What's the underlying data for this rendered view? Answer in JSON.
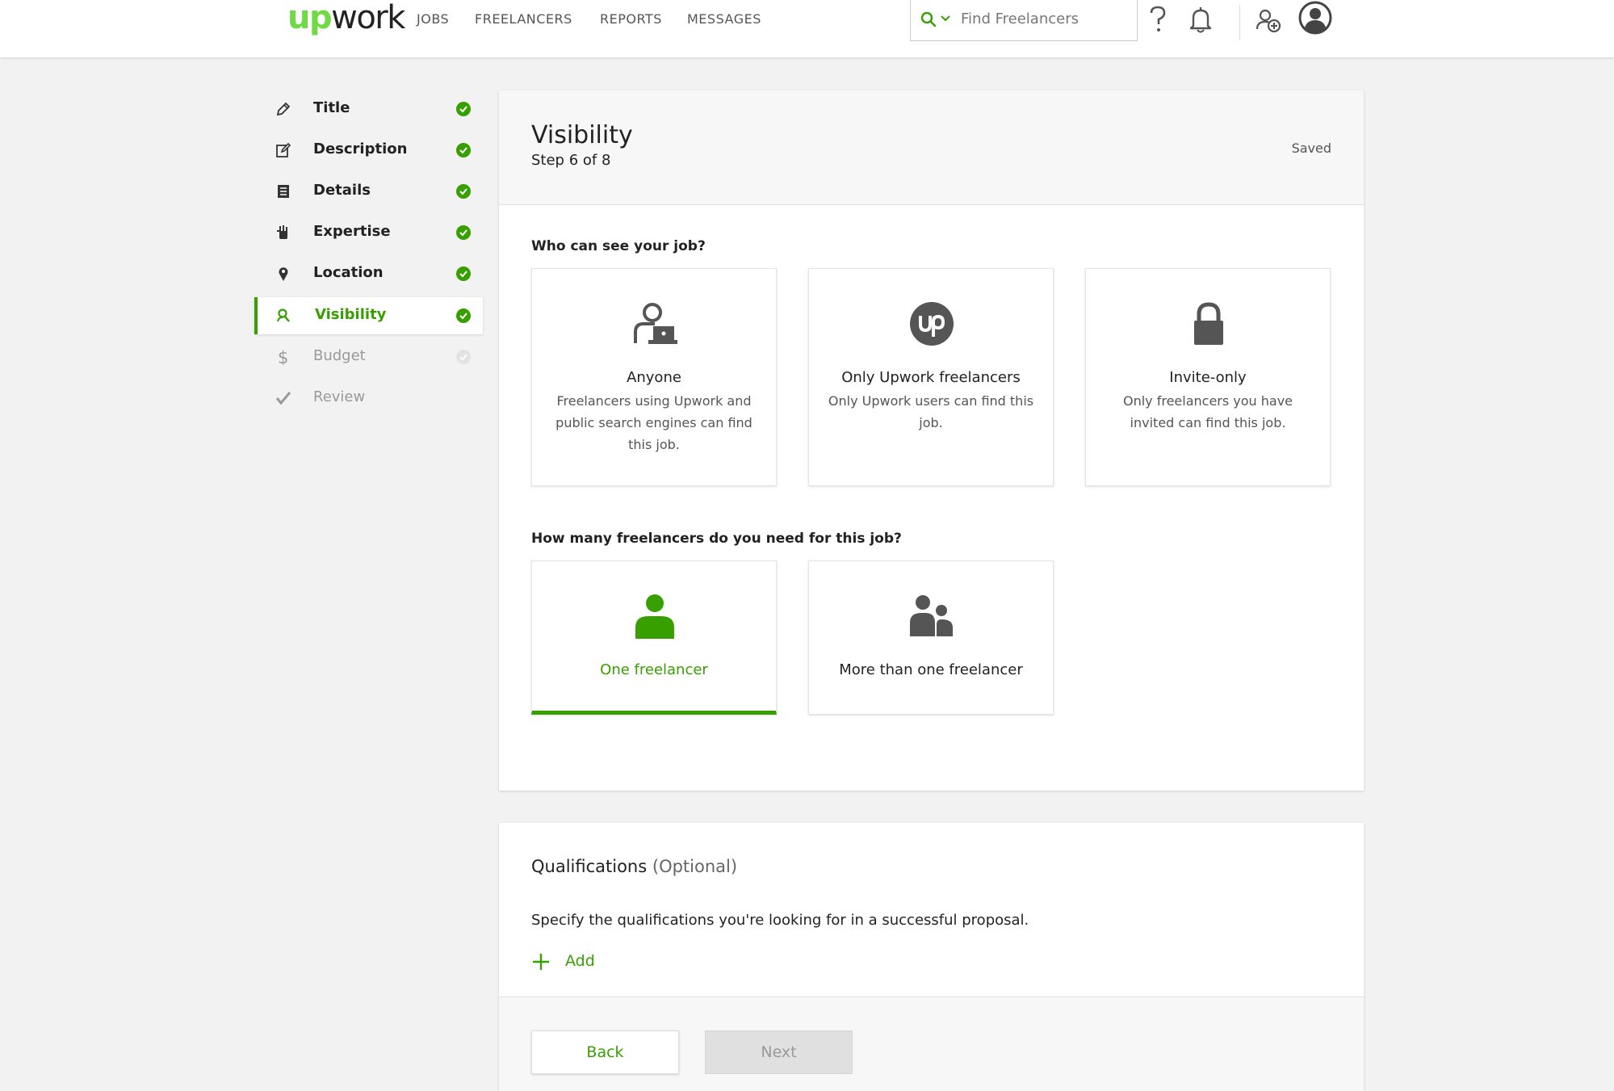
{
  "header": {
    "logo_up": "up",
    "logo_work": "work",
    "nav": [
      "JOBS",
      "FREELANCERS",
      "REPORTS",
      "MESSAGES"
    ],
    "search_placeholder": "Find Freelancers"
  },
  "sidebar": {
    "items": [
      {
        "label": "Title",
        "icon": "pencil-icon",
        "status": "complete"
      },
      {
        "label": "Description",
        "icon": "edit-icon",
        "status": "complete"
      },
      {
        "label": "Details",
        "icon": "list-icon",
        "status": "complete"
      },
      {
        "label": "Expertise",
        "icon": "hand-icon",
        "status": "complete"
      },
      {
        "label": "Location",
        "icon": "map-pin-icon",
        "status": "complete"
      },
      {
        "label": "Visibility",
        "icon": "user-search-icon",
        "status": "complete",
        "active": true
      },
      {
        "label": "Budget",
        "icon": "dollar-icon",
        "status": "pending"
      },
      {
        "label": "Review",
        "icon": "checkmark-icon",
        "status": "pending"
      }
    ]
  },
  "main": {
    "title": "Visibility",
    "step": "Step 6 of 8",
    "saved": "Saved",
    "visibility_question": "Who can see your job?",
    "visibility_options": [
      {
        "title": "Anyone",
        "desc": "Freelancers using Upwork and public search engines can find this job.",
        "icon": "user-laptop-icon"
      },
      {
        "title": "Only Upwork freelancers",
        "desc": "Only Upwork users can find this job.",
        "icon": "upwork-logo-icon"
      },
      {
        "title": "Invite-only",
        "desc": "Only freelancers you have invited can find this job.",
        "icon": "lock-icon"
      }
    ],
    "count_question": "How many freelancers do you need for this job?",
    "count_options": [
      {
        "title": "One freelancer",
        "icon": "single-user-icon",
        "selected": true
      },
      {
        "title": "More than one freelancer",
        "icon": "group-users-icon",
        "selected": false
      }
    ]
  },
  "qualifications": {
    "title": "Qualifications",
    "optional": "(Optional)",
    "description": "Specify the qualifications you're looking for in a successful proposal.",
    "add_label": "Add",
    "back_label": "Back",
    "next_label": "Next"
  },
  "colors": {
    "accent": "#37a000",
    "logo_green": "#6fda44",
    "disabled": "#999999"
  }
}
